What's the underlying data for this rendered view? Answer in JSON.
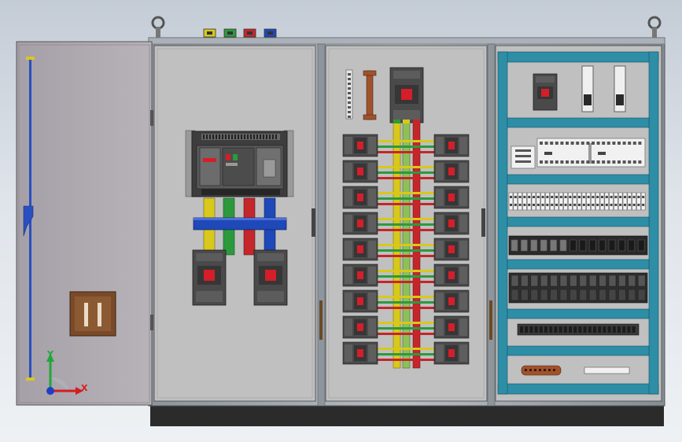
{
  "axis_triad": {
    "x_label": "X",
    "y_label": "Y"
  },
  "colors": {
    "background_top": "#c4ccd6",
    "cabinet_frame": "#9aa3ac",
    "panel": "#c0c0c0",
    "door": "#ada6ae",
    "plinth": "#2b2b2b",
    "din_rail_teal": "#2d8ea6",
    "busbar_yellow": "#d8c81c",
    "busbar_green": "#2c9a3c",
    "busbar_red": "#c4262a",
    "busbar_blue": "#1f48b8",
    "breaker_dark": "#4a4a4a",
    "breaker_red_handle": "#d41e2a",
    "door_rod": "#2a4fc0",
    "handle_wood": "#7a4a28"
  },
  "icons": [
    "lifting-eye-icon",
    "axis-triad-icon",
    "door-handle-icon",
    "cable-gland-icon"
  ]
}
